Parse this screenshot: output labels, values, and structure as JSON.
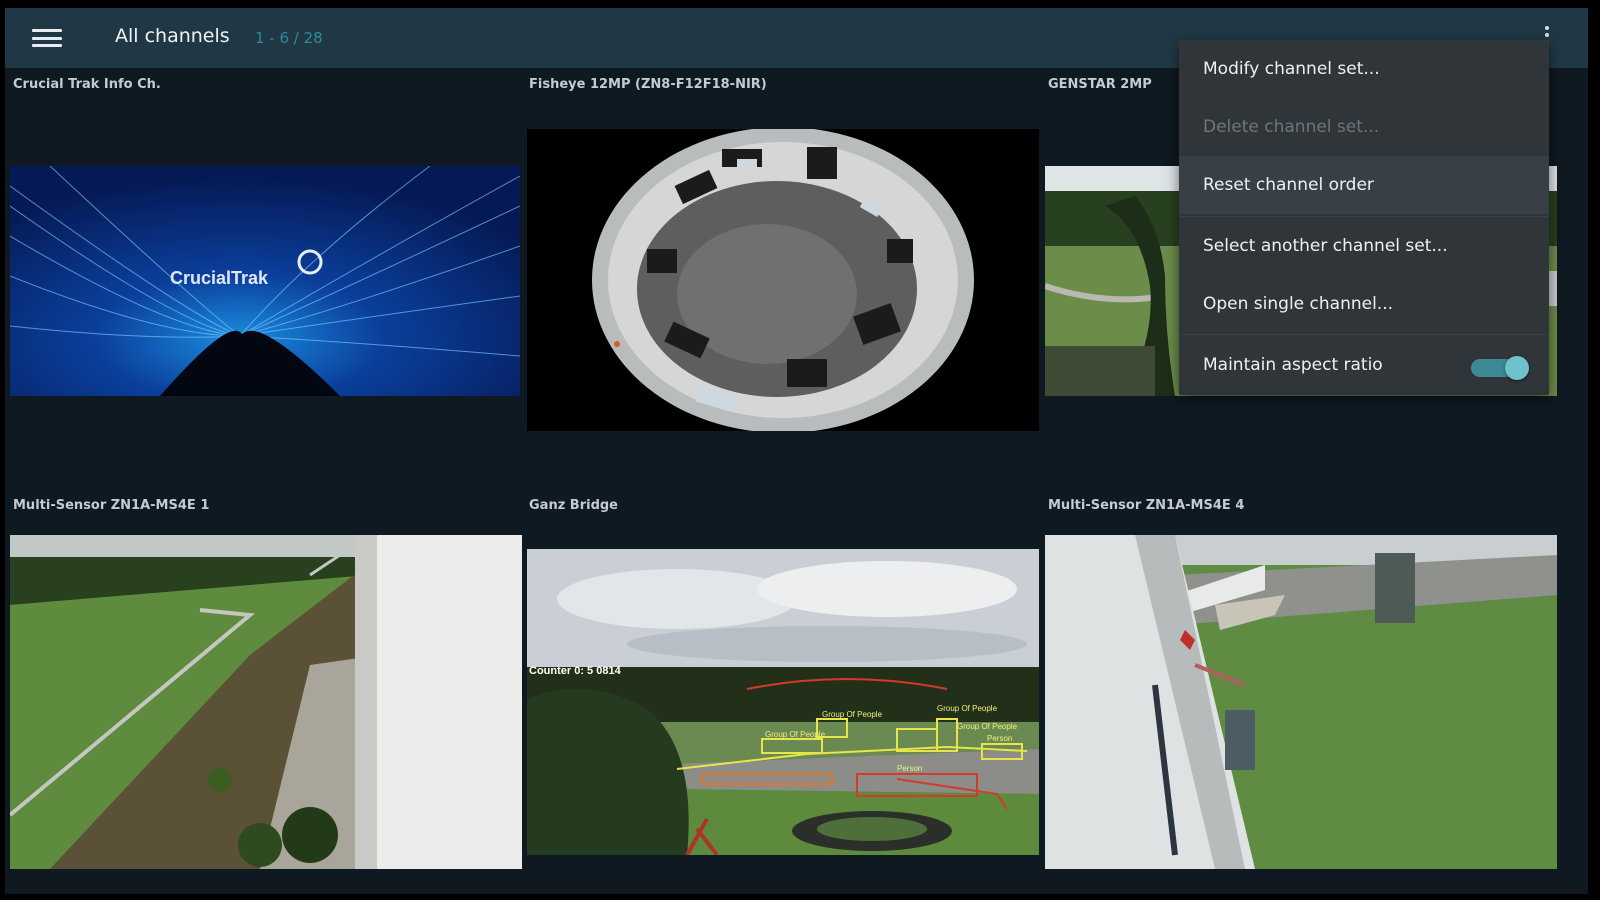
{
  "header": {
    "title": "All channels",
    "range": "1 - 6 / 28"
  },
  "channels": [
    {
      "label": "Crucial Trak Info Ch."
    },
    {
      "label": "Fisheye 12MP (ZN8-F12F18-NIR)"
    },
    {
      "label": "GENSTAR 2MP"
    },
    {
      "label": "Multi-Sensor ZN1A-MS4E 1"
    },
    {
      "label": "Ganz Bridge"
    },
    {
      "label": "Multi-Sensor ZN1A-MS4E 4"
    }
  ],
  "feeds": {
    "logo_text": "CrucialTrak",
    "counter_text": "Counter 0: 5 0814",
    "overlays": [
      "Group Of People",
      "Group Of People",
      "Group Of People",
      "Group Of People",
      "Person",
      "Person"
    ]
  },
  "menu": {
    "items": [
      {
        "label": "Modify channel set...",
        "enabled": true
      },
      {
        "label": "Delete channel set...",
        "enabled": false
      },
      {
        "label": "Reset channel order",
        "enabled": true
      },
      {
        "label": "Select another channel set...",
        "enabled": true
      },
      {
        "label": "Open single channel...",
        "enabled": true
      },
      {
        "label": "Maintain aspect ratio",
        "enabled": true,
        "checked": true
      }
    ]
  },
  "colors": {
    "topbar": "#203845",
    "background": "#0f1921",
    "accent": "#3b8a96",
    "menu": "#2f3539"
  }
}
